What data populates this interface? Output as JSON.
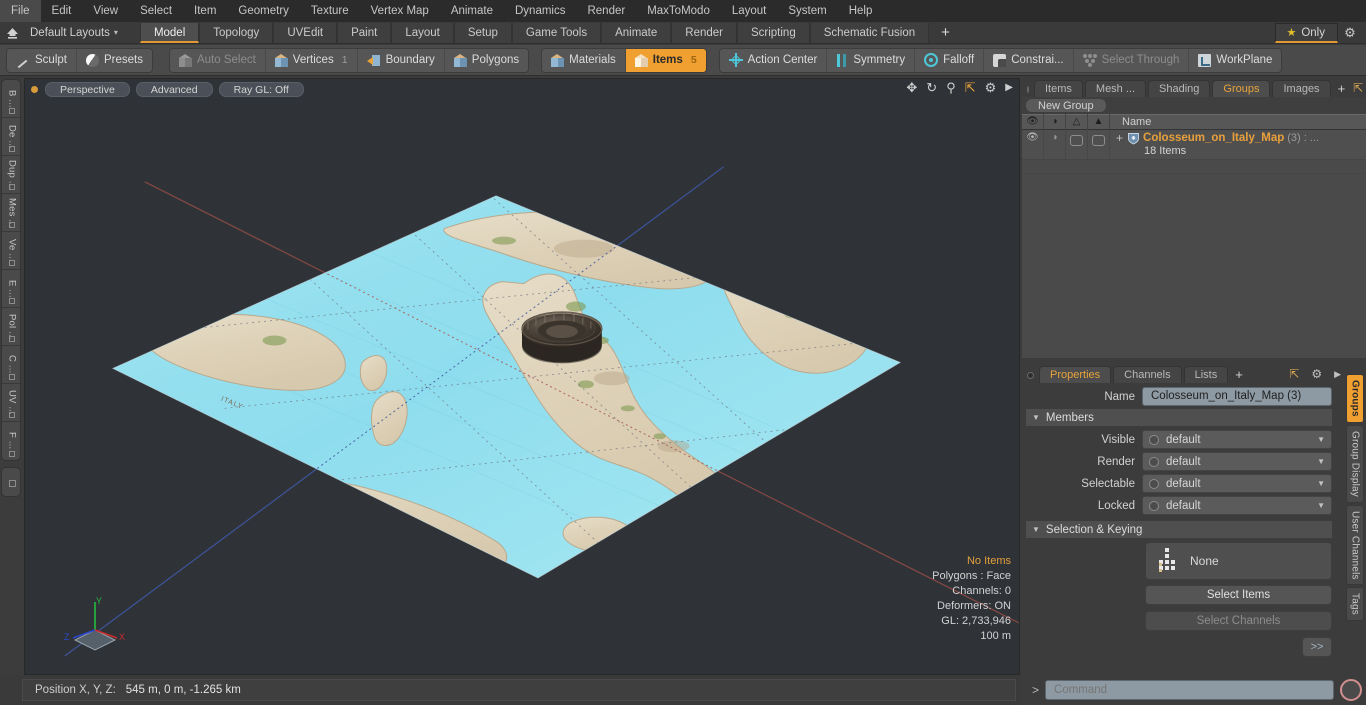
{
  "app": {
    "menubar": [
      "File",
      "Edit",
      "View",
      "Select",
      "Item",
      "Geometry",
      "Texture",
      "Vertex Map",
      "Animate",
      "Dynamics",
      "Render",
      "MaxToModo",
      "Layout",
      "System",
      "Help"
    ]
  },
  "layoutbar": {
    "home_icon": "home-icon",
    "layouts_label": "Default Layouts",
    "caret": "▾",
    "tabs": [
      {
        "label": "Model",
        "active": true
      },
      {
        "label": "Topology",
        "active": false
      },
      {
        "label": "UVEdit",
        "active": false
      },
      {
        "label": "Paint",
        "active": false
      },
      {
        "label": "Layout",
        "active": false
      },
      {
        "label": "Setup",
        "active": false
      },
      {
        "label": "Game Tools",
        "active": false
      },
      {
        "label": "Animate",
        "active": false
      },
      {
        "label": "Render",
        "active": false
      },
      {
        "label": "Scripting",
        "active": false
      },
      {
        "label": "Schematic Fusion",
        "active": false
      }
    ],
    "plus": "+",
    "only_label": "Only",
    "star": "★",
    "gear": "⚙"
  },
  "toolbar": {
    "left_group": [
      {
        "label": "Sculpt",
        "icon": "pencil-icon",
        "state": "normal"
      },
      {
        "label": "Presets",
        "icon": "sphere-icon",
        "state": "normal"
      }
    ],
    "select_group": [
      {
        "label": "Auto Select",
        "icon": "cube-icon",
        "state": "dim",
        "count": ""
      },
      {
        "label": "Vertices",
        "icon": "cube-icon",
        "state": "normal",
        "count": "1"
      },
      {
        "label": "Boundary",
        "icon": "boundary-icon",
        "state": "normal",
        "count": ""
      },
      {
        "label": "Polygons",
        "icon": "cube-icon",
        "state": "normal",
        "count": ""
      }
    ],
    "mode_group": [
      {
        "label": "Materials",
        "icon": "cube-icon",
        "state": "normal",
        "count": ""
      },
      {
        "label": "Items",
        "icon": "cube-icon",
        "state": "selected",
        "count": "5"
      }
    ],
    "right_group": [
      {
        "label": "Action Center",
        "icon": "action-center-icon",
        "state": "normal"
      },
      {
        "label": "Symmetry",
        "icon": "symmetry-icon",
        "state": "normal"
      },
      {
        "label": "Falloff",
        "icon": "falloff-icon",
        "state": "normal"
      },
      {
        "label": "Constrai...",
        "icon": "constraint-icon",
        "state": "normal"
      },
      {
        "label": "Select Through",
        "icon": "select-through-icon",
        "state": "dim"
      },
      {
        "label": "WorkPlane",
        "icon": "workplane-icon",
        "state": "normal"
      }
    ]
  },
  "left_tabs": [
    "B ...",
    "De ...",
    "Dup ...",
    "Mes ...",
    "Ve ...",
    "E ...",
    "Pol ...",
    "C ...",
    "UV ...",
    "F ..."
  ],
  "viewport": {
    "mode_buttons": [
      "Perspective",
      "Advanced",
      "Ray GL: Off"
    ],
    "tool_icons": [
      "pan-icon",
      "rotate-icon",
      "zoom-icon",
      "maximize-icon",
      "gear-icon",
      "play-icon"
    ],
    "stats": [
      {
        "label": "No Items",
        "highlight": true
      },
      {
        "label": "Polygons : Face",
        "highlight": false
      },
      {
        "label": "Channels: 0",
        "highlight": false
      },
      {
        "label": "Deformers: ON",
        "highlight": false
      },
      {
        "label": "GL: 2,733,946",
        "highlight": false
      },
      {
        "label": "100 m",
        "highlight": false
      }
    ],
    "axis_labels": {
      "x": "X",
      "y": "Y",
      "z": "Z"
    }
  },
  "right_panel": {
    "tabs": [
      {
        "label": "Items",
        "active": false
      },
      {
        "label": "Mesh ...",
        "active": false
      },
      {
        "label": "Shading",
        "active": false
      },
      {
        "label": "Groups",
        "active": true
      },
      {
        "label": "Images",
        "active": false
      }
    ],
    "tab_plus": "+",
    "new_group_button": "New Group",
    "list_header": {
      "col_icons": [
        "eye-icon",
        "render-icon",
        "shade-icon",
        "wire-icon"
      ],
      "name": "Name"
    },
    "rows": [
      {
        "plus": "+",
        "name": "Colosseum_on_Italy_Map",
        "count": "(3) :",
        "ellipsis": "...",
        "sub": "18 Items"
      }
    ]
  },
  "properties": {
    "tabs": [
      {
        "label": "Properties",
        "active": true
      },
      {
        "label": "Channels",
        "active": false
      },
      {
        "label": "Lists",
        "active": false
      }
    ],
    "tab_plus": "+",
    "name_label": "Name",
    "name_value": "Colosseum_on_Italy_Map (3)",
    "members_section": "Members",
    "members": [
      {
        "label": "Visible",
        "value": "default"
      },
      {
        "label": "Render",
        "value": "default"
      },
      {
        "label": "Selectable",
        "value": "default"
      },
      {
        "label": "Locked",
        "value": "default"
      }
    ],
    "selection_section": "Selection & Keying",
    "selection_none": "None",
    "select_items_button": "Select Items",
    "select_channels_button": "Select Channels",
    "expand_button": ">>"
  },
  "right_vtabs": [
    {
      "label": "Groups",
      "active": true
    },
    {
      "label": "Group Display",
      "active": false
    },
    {
      "label": "User Channels",
      "active": false
    },
    {
      "label": "Tags",
      "active": false
    }
  ],
  "statusbar": {
    "position_label": "Position X, Y, Z:",
    "position_value": "545 m, 0 m, -1.265 km"
  },
  "command": {
    "prompt": ">",
    "placeholder": "Command",
    "record_icon": "record-icon"
  },
  "colors": {
    "accent_orange": "#e8a03c",
    "selected_orange": "#f0a030",
    "panel_bg": "#3c3c3c",
    "toolbar_bg": "#4a4a4a",
    "viewport_bg": "#2f3338",
    "menubar_bg": "#2b2b2b",
    "field_blue": "#8e9aa3"
  }
}
